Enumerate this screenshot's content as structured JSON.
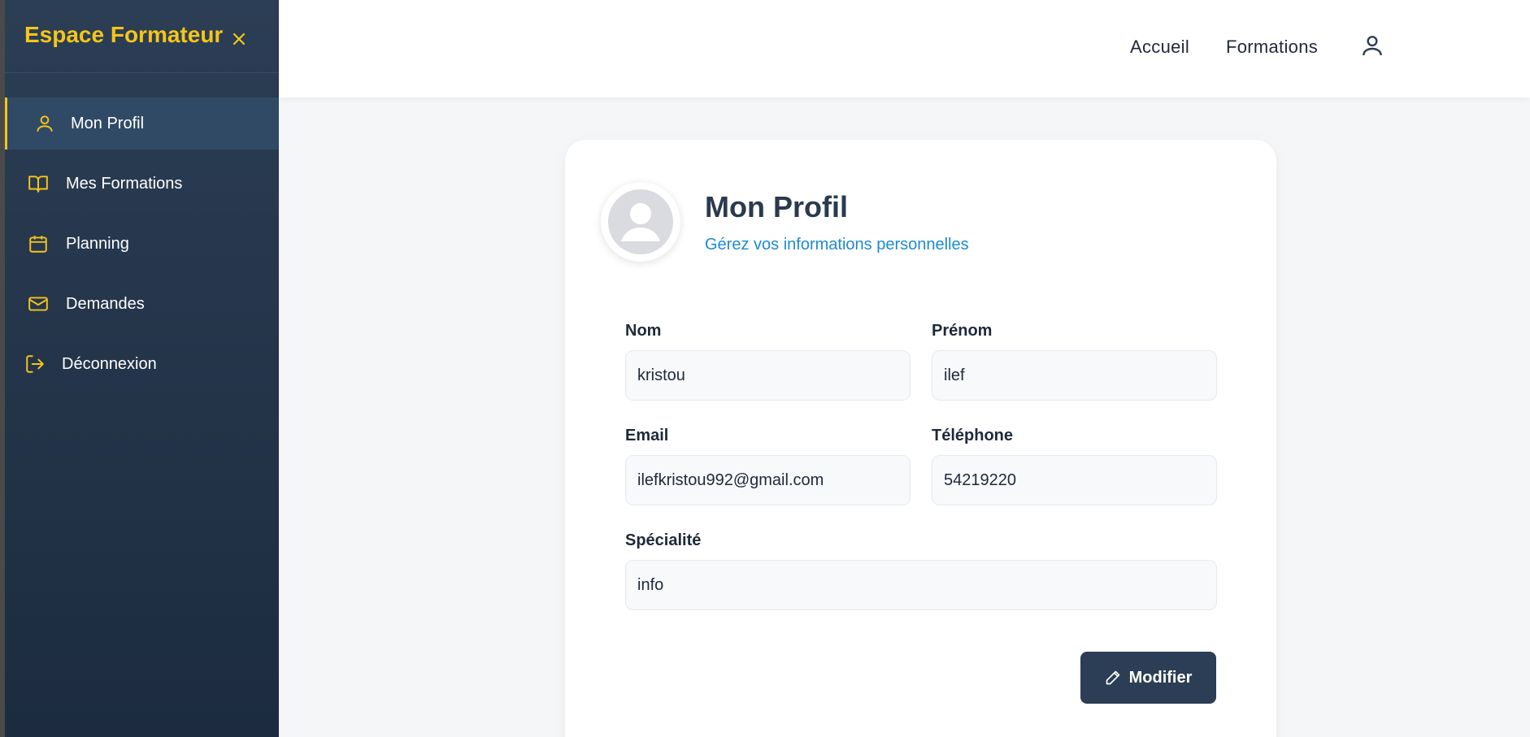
{
  "sidebar": {
    "title": "Espace Formateur",
    "close_icon": "close-icon",
    "items": [
      {
        "label": "Mon Profil",
        "icon": "user-icon",
        "active": true
      },
      {
        "label": "Mes Formations",
        "icon": "book-icon",
        "active": false
      },
      {
        "label": "Planning",
        "icon": "calendar-icon",
        "active": false
      },
      {
        "label": "Demandes",
        "icon": "mail-icon",
        "active": false
      },
      {
        "label": "Déconnexion",
        "icon": "logout-icon",
        "active": false
      }
    ]
  },
  "topbar": {
    "links": [
      "Accueil",
      "Formations"
    ],
    "user_icon": "user-icon"
  },
  "profile": {
    "title": "Mon Profil",
    "subtitle": "Gérez vos informations personnelles",
    "fields": {
      "nom": {
        "label": "Nom",
        "value": "kristou"
      },
      "prenom": {
        "label": "Prénom",
        "value": "ilef"
      },
      "email": {
        "label": "Email",
        "value": "ilefkristou992@gmail.com"
      },
      "telephone": {
        "label": "Téléphone",
        "value": "54219220"
      },
      "specialite": {
        "label": "Spécialité",
        "value": "info"
      }
    },
    "edit_button": "Modifier"
  },
  "colors": {
    "accent": "#f5c518",
    "sidebar_bg": "#2c3e55",
    "link_blue": "#1d8bd0",
    "button_bg": "#2c3e55"
  }
}
